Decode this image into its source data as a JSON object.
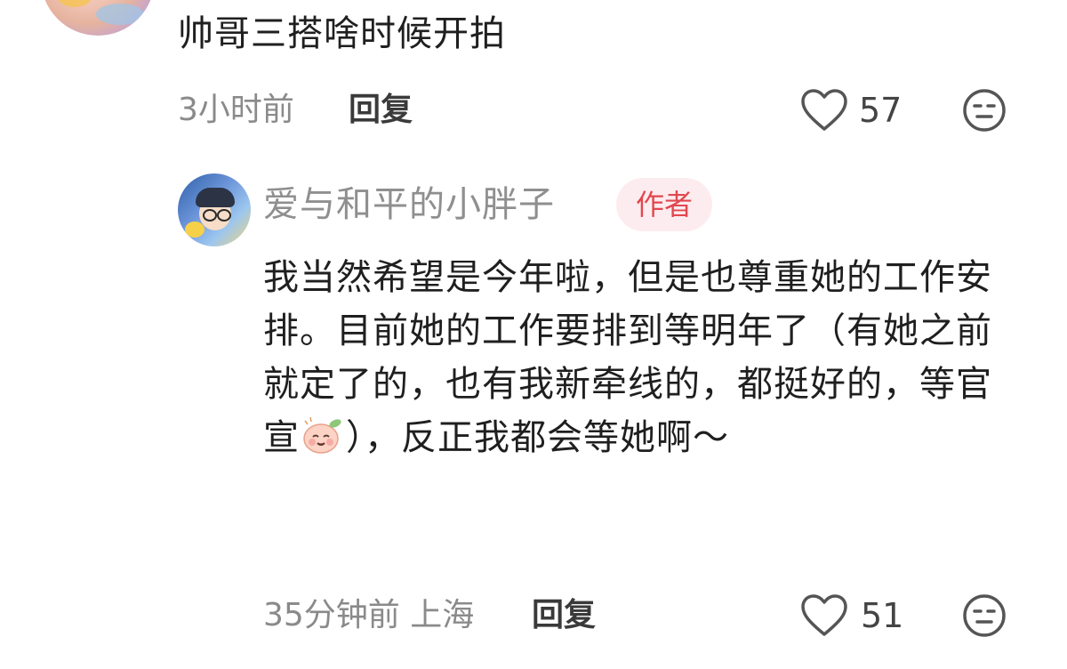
{
  "comment": {
    "text": "帅哥三搭啥时候开拍",
    "time": "3小时前",
    "reply_label": "回复",
    "likes": "57"
  },
  "author_reply": {
    "name": "爱与和平的小胖子",
    "badge": "作者",
    "text_before_emoji": "我当然希望是今年啦，但是也尊重她的工作安排。目前她的工作要排到等明年了（有她之前就定了的，也有我新牵线的，都挺好的，等官宣",
    "text_after_emoji": "），反正我都会等她啊～",
    "emoji_icon": "peach-blush-emoji",
    "time_location": "35分钟前 上海",
    "reply_label": "回复",
    "likes": "51"
  },
  "colors": {
    "badge_bg": "#fdecef",
    "badge_text": "#e0484f",
    "meta_gray": "#8a8a8a"
  }
}
